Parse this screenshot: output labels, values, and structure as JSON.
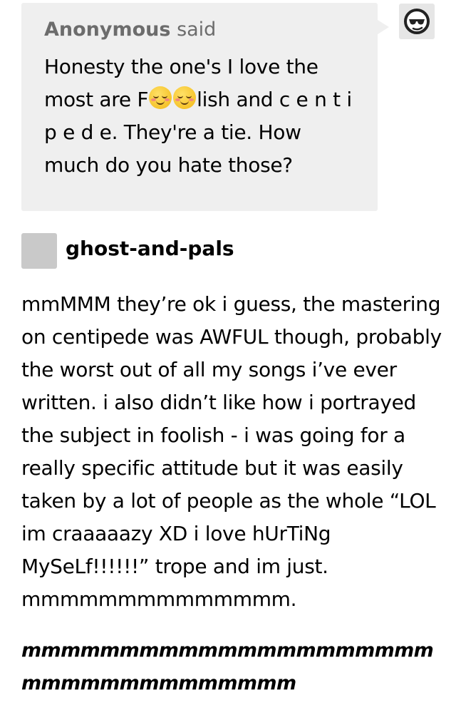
{
  "ask": {
    "asker_name": "Anonymous",
    "asker_verb": "said",
    "question_part1": "Honesty the one's I love the most are F",
    "question_part2": "lish and c e n t i p e d e. They're a tie. How much do you hate those?",
    "emoji_icons": [
      "smiling-face-icon",
      "smiling-face-icon"
    ],
    "background_color": "#efefef",
    "asker_color": "#6c6c6c"
  },
  "anon_avatar": {
    "icon": "anonymous-sunglasses-icon"
  },
  "answer": {
    "username": "ghost-and-pals",
    "body": "mmMMM they’re ok i guess, the mastering on centipede was AWFUL though, probably the worst out of all my songs i’ve ever written. i also didn’t like how i portrayed the subject in foolish - i was going for a really specific attitude but it was easily taken by a lot of people as the whole “LOL im craaaaazy XD i love hUrTiNg MySeLf!!!!!!” trope and im just. mmmmmmmmmmmmmm.",
    "emphasis": "mmmmmmmmmmmmmmmmmmmmmmmmmmmmmmmmmmm",
    "avatar_color": "#c9c9c9"
  }
}
